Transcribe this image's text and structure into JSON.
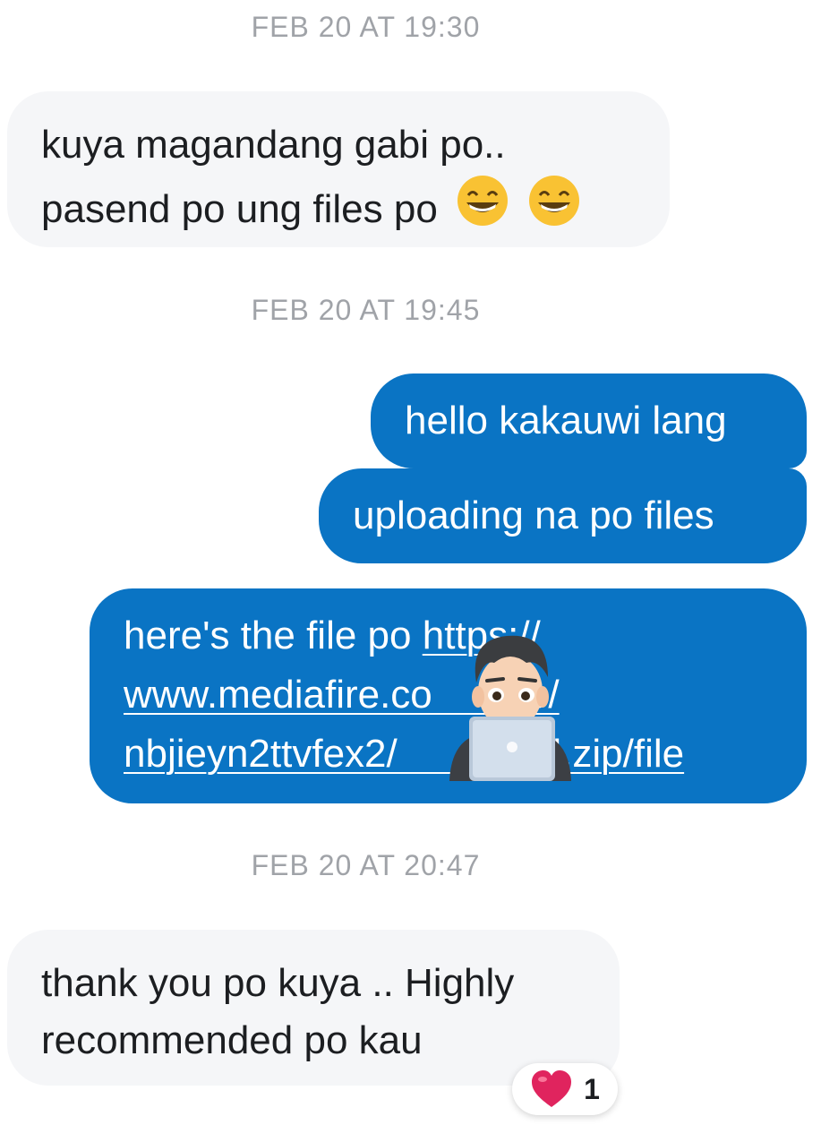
{
  "timestamps": [
    "FEB 20 AT 19:30",
    "FEB 20 AT 19:45",
    "FEB 20 AT 20:47"
  ],
  "messages": {
    "m1_line1": "kuya magandang gabi po..",
    "m1_line2": "pasend po ung files po",
    "m1_emoji": "grinning-face-emoji",
    "m2": "hello kakauwi lang",
    "m3": "uploading na po files",
    "m4_prefix": "here's the file po ",
    "m4_link_line1": "https://",
    "m4_link_line2": "www.mediafire.co       ile/",
    "m4_link_line3": "nbjieyn2ttvfex2/           ed.zip/file",
    "m5_line1": "thank you po kuya .. Highly",
    "m5_line2": "recommended po kau"
  },
  "reaction": {
    "emoji": "heart",
    "count": "1"
  },
  "colors": {
    "incoming_bubble": "#f5f6f8",
    "outgoing_bubble": "#0a74c4",
    "timestamp": "#a0a3a8",
    "heart": "#e0245e"
  },
  "overlay": {
    "icon": "memoji-with-laptop-icon"
  }
}
